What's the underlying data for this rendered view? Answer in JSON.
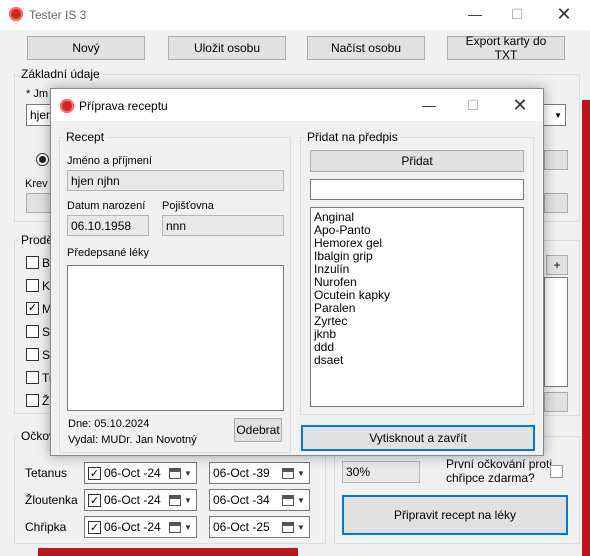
{
  "main": {
    "title": "Tester IS 3",
    "buttons": {
      "new": "Nový",
      "save": "Uložit osobu",
      "load": "Načíst osobu",
      "export": "Export karty do TXT"
    },
    "basic_group": "Základní údaje",
    "name_label_partial": "* Jm",
    "name_value_partial": "hjen",
    "blood_label_partial": "Krev",
    "diseases_group_partial": "Prodě",
    "disease_rows": [
      {
        "label": "Bi",
        "checked": false
      },
      {
        "label": "K",
        "checked": false
      },
      {
        "label": "M",
        "checked": true
      },
      {
        "label": "Sl",
        "checked": false
      },
      {
        "label": "Si",
        "checked": false
      },
      {
        "label": "Tu",
        "checked": false
      },
      {
        "label": "Ž",
        "checked": false
      }
    ],
    "plus": "+",
    "vacc_group_partial": "Očkov",
    "vaccinations": [
      {
        "name": "Tetanus",
        "date1": "06-Oct -24",
        "date2": "06-Oct -39"
      },
      {
        "name": "Žloutenka",
        "date1": "06-Oct -24",
        "date2": "06-Oct -34"
      },
      {
        "name": "Chřipka",
        "date1": "06-Oct -24",
        "date2": "06-Oct -25"
      }
    ],
    "discount_value": "30%",
    "flu_free_label": "První očkování proti chřipce zdarma?",
    "prepare_button": "Připravit recept na léky"
  },
  "dialog": {
    "title": "Příprava receptu",
    "recept_group": "Recept",
    "name_label": "Jméno a příjmení",
    "name_value": "hjen njhn",
    "birth_label": "Datum narození",
    "birth_value": "06.10.1958",
    "insurance_label": "Pojišťovna",
    "insurance_value": "nnn",
    "drugs_label": "Předepsané léky",
    "date_line": "Dne: 05.10.2024",
    "doctor_line": "Vydal: MUDr. Jan Novotný",
    "remove_button": "Odebrat",
    "add_group": "Přidat na předpis",
    "add_button": "Přidat",
    "search_value": "",
    "drug_list": [
      "Anginal",
      "Apo-Panto",
      "Hemorex gel",
      "Ibalgin grip",
      "Inzulín",
      "Nurofen",
      "Ocutein kapky",
      "Paralen",
      "Zyrtec",
      "jknb",
      "ddd",
      "dsaet"
    ],
    "print_button": "Vytisknout a zavřít"
  },
  "colors": {
    "accent_red": "#c0141c",
    "focus_blue": "#0078d7"
  }
}
